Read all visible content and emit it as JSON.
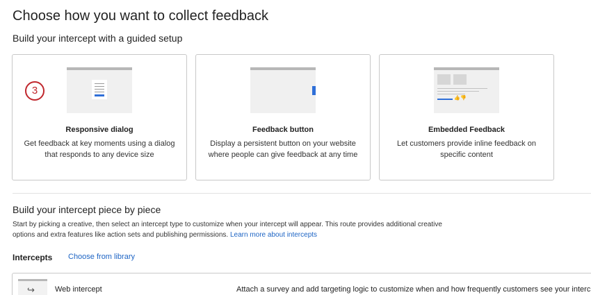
{
  "page": {
    "title": "Choose how you want to collect feedback",
    "guided_subtitle": "Build your intercept with a guided setup"
  },
  "cards": [
    {
      "title": "Responsive dialog",
      "description": "Get feedback at key moments using a dialog that responds to any device size",
      "icon": "dialog-thumbnail"
    },
    {
      "title": "Feedback button",
      "description": "Display a persistent button on your website where people can give feedback at any time",
      "icon": "feedback-button-thumbnail"
    },
    {
      "title": "Embedded Feedback",
      "description": "Let customers provide inline feedback on specific content",
      "icon": "embedded-feedback-thumbnail"
    }
  ],
  "step_badge": "3",
  "piece_by_piece": {
    "title": "Build your intercept piece by piece",
    "description": "Start by picking a creative, then select an intercept type to customize when your intercept will appear. This route provides additional creative options and extra features like action sets and publishing permissions. ",
    "link": "Learn more about intercepts"
  },
  "intercepts": {
    "label": "Intercepts",
    "library_link": "Choose from library",
    "rows": [
      {
        "name": "Web intercept",
        "description": "Attach a survey and add targeting logic to customize when and how frequently customers see your interc",
        "icon": "web-intercept-icon"
      }
    ]
  },
  "colors": {
    "accent": "#2f6fd8",
    "link": "#1d64c4",
    "badge": "#c0272d"
  }
}
